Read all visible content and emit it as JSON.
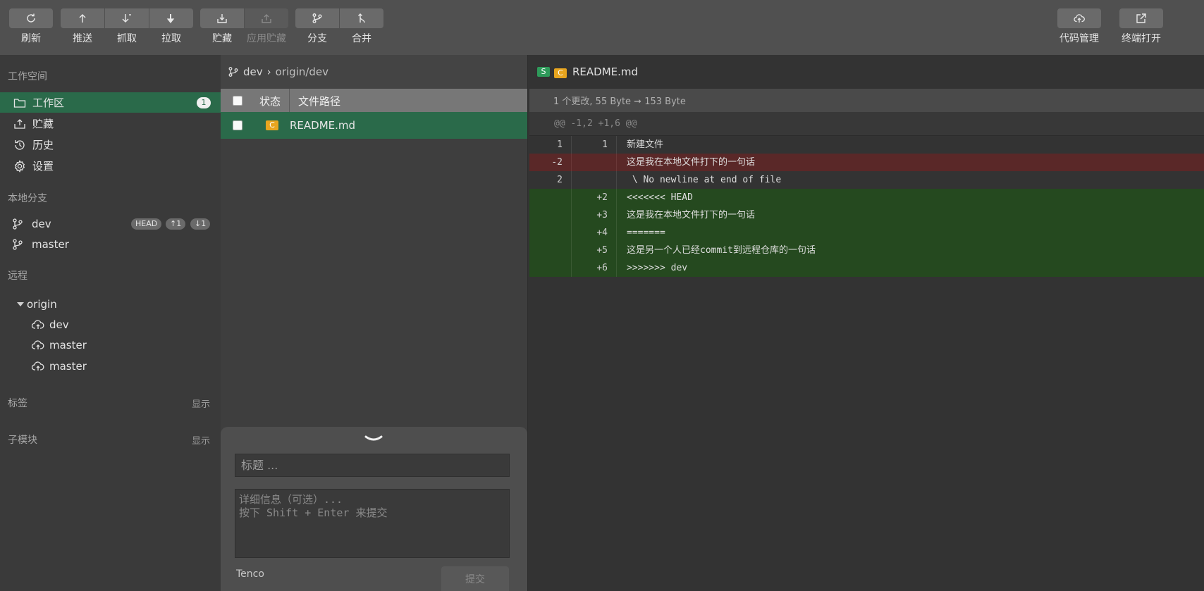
{
  "toolbar": {
    "refresh": "刷新",
    "push": "推送",
    "fetch": "抓取",
    "pull": "拉取",
    "stash": "贮藏",
    "apply_stash": "应用贮藏",
    "branch": "分支",
    "merge": "合并",
    "code_manage": "代码管理",
    "terminal_open": "终端打开"
  },
  "sidebar": {
    "workspace_title": "工作空间",
    "workspace_items": [
      {
        "label": "工作区",
        "badge": "1"
      },
      {
        "label": "贮藏"
      },
      {
        "label": "历史"
      },
      {
        "label": "设置"
      }
    ],
    "local_title": "本地分支",
    "local_branches": [
      {
        "name": "dev",
        "head": "HEAD",
        "ahead": "↑1",
        "behind": "↓1"
      },
      {
        "name": "master"
      }
    ],
    "remote_title": "远程",
    "remote_name": "origin",
    "remote_branches": [
      "dev",
      "master",
      "master"
    ],
    "tags_title": "标签",
    "tags_show": "显示",
    "submodule_title": "子模块",
    "submodule_show": "显示"
  },
  "files": {
    "branch": "dev",
    "separator": "›",
    "upstream": "origin/dev",
    "col_status": "状态",
    "col_path": "文件路径",
    "rows": [
      {
        "status": "C",
        "path": "README.md"
      }
    ]
  },
  "commit": {
    "title_placeholder": "标题 ...",
    "detail_placeholder": "详细信息（可选）...\n按下 Shift + Enter 来提交",
    "author": "Tenco",
    "submit": "提交"
  },
  "diff": {
    "badge_s": "S",
    "badge_c": "C",
    "filename": "README.md",
    "summary": "1 个更改, 55 Byte ➞ 153 Byte",
    "hunk": "@@ -1,2 +1,6 @@",
    "lines": [
      {
        "type": "ctx",
        "old": "1",
        "new": "1",
        "text": "新建文件"
      },
      {
        "type": "del",
        "old": "-2",
        "new": "",
        "text": "这是我在本地文件打下的一句话"
      },
      {
        "type": "ctx",
        "old": "2",
        "new": "",
        "text": " \\ No newline at end of file"
      },
      {
        "type": "add",
        "old": "",
        "new": "+2",
        "text": "<<<<<<< HEAD"
      },
      {
        "type": "add",
        "old": "",
        "new": "+3",
        "text": "这是我在本地文件打下的一句话"
      },
      {
        "type": "add",
        "old": "",
        "new": "+4",
        "text": "======="
      },
      {
        "type": "add",
        "old": "",
        "new": "+5",
        "text": "这是另一个人已经commit到远程仓库的一句话"
      },
      {
        "type": "add",
        "old": "",
        "new": "+6",
        "text": ">>>>>>> dev"
      }
    ]
  },
  "colors": {
    "accent": "#2a6a4a",
    "conflict": "#e8a51f",
    "staged": "#2e9a5a",
    "deleted_bg": "#5a2828",
    "added_bg": "#25491f"
  }
}
